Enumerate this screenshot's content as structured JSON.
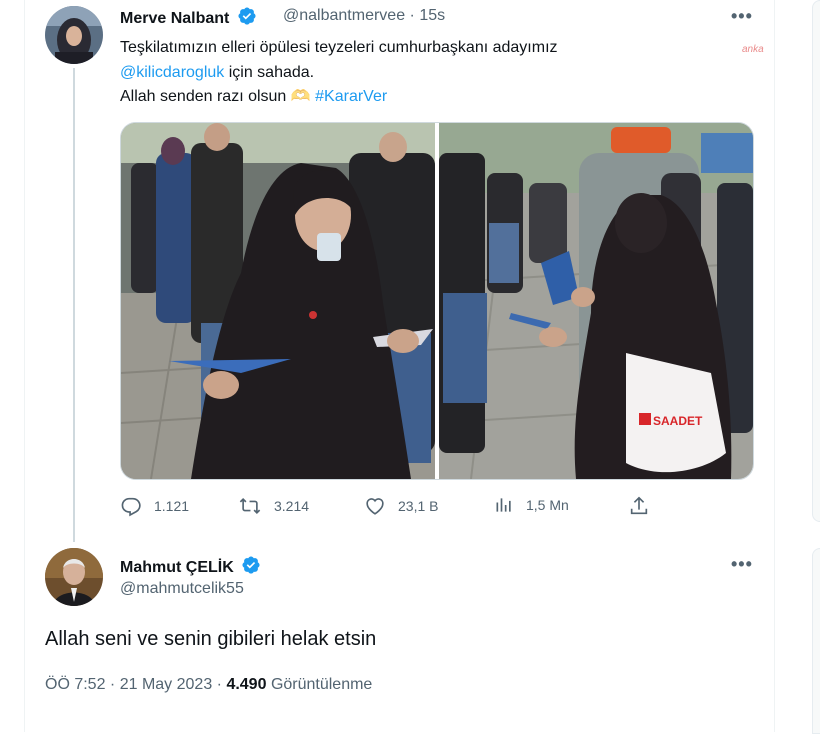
{
  "tweet": {
    "name": "Merve Nalbant",
    "handle": "@nalbantmervee",
    "time": "15s",
    "line1": "Teşkilatımızın elleri öpülesi teyzeleri cumhurbaşkanı adayımız",
    "mention": "@kilicdarogluk",
    "line2_rest": " için sahada.",
    "line3": "Allah senden razı olsun",
    "emoji": "🫶",
    "hashtag": "#KararVer",
    "more": "•••",
    "stats": {
      "replies": "1.121",
      "retweets": "3.214",
      "likes": "23,1 B",
      "views": "1,5 Mn"
    },
    "media_bag_text": "SAADET"
  },
  "reply": {
    "name": "Mahmut ÇELİK",
    "handle": "@mahmutcelik55",
    "more": "•••",
    "body": "Allah seni ve senin gibileri helak etsin",
    "time": "ÖÖ 7:52",
    "date": "21 May 2023",
    "views": "4.490",
    "views_label": "Görüntülenme",
    "sep": " · "
  },
  "watermark": "anka",
  "colors": {
    "accent": "#1d9bf0",
    "muted": "#536471",
    "text": "#0f1419"
  },
  "icons": [
    "verified-badge-icon",
    "reply-icon",
    "retweet-icon",
    "like-icon",
    "views-icon",
    "share-icon",
    "more-icon"
  ]
}
